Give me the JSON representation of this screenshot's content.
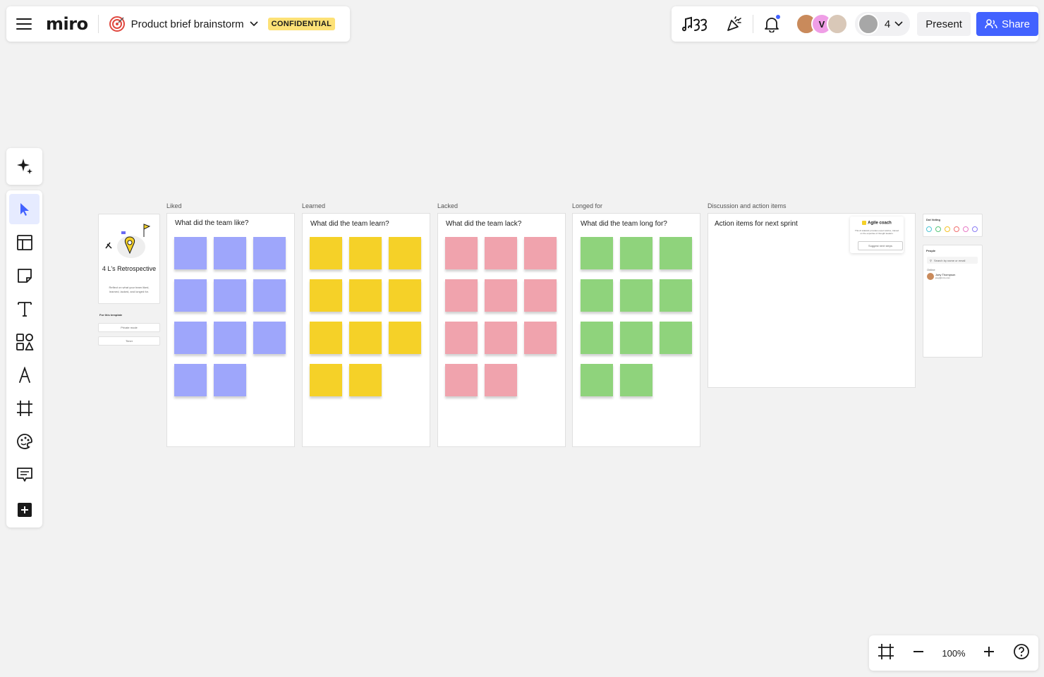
{
  "header": {
    "logo": "miro",
    "board_title": "Product brief brainstorm",
    "badge": "CONFIDENTIAL"
  },
  "topbar": {
    "avatars": [
      {
        "initial": "",
        "color": "#c98a5b"
      },
      {
        "initial": "V",
        "color": "#ef9ee6"
      },
      {
        "initial": "",
        "color": "#d9c8b8"
      }
    ],
    "collaborator_count": "4",
    "present_label": "Present",
    "share_label": "Share",
    "accent": "#4262ff"
  },
  "toolbar": {
    "tools": [
      "ai-sparkle-icon",
      "select-cursor-icon",
      "templates-icon",
      "sticky-note-icon",
      "text-icon",
      "shapes-icon",
      "pen-icon",
      "frame-icon",
      "reactions-icon",
      "comment-icon",
      "more-tools-icon"
    ]
  },
  "zoom": {
    "level": "100%"
  },
  "canvas": {
    "template_card": {
      "title": "4 L's Retrospective",
      "description": "Reflect on what your team liked, learned, lacked, and longed for.",
      "section": "For this template",
      "btn1": "Private mode",
      "btn2": "Timer"
    },
    "frames": [
      {
        "label": "Liked",
        "question": "What did the team like?",
        "color": "#9ea6fb",
        "count": 11
      },
      {
        "label": "Learned",
        "question": "What did the team learn?",
        "color": "#f5d128",
        "count": 11
      },
      {
        "label": "Lacked",
        "question": "What did the team lack?",
        "color": "#f0a3ad",
        "count": 11
      },
      {
        "label": "Longed for",
        "question": "What did the team long for?",
        "color": "#8fd37c",
        "count": 11
      }
    ],
    "discussion": {
      "label": "Discussion and action items",
      "title": "Action items for next sprint",
      "coach_title": "Agile coach",
      "coach_desc": "This Al sidekick provides expert advice, trained on the expertise of thought leaders.",
      "coach_btn": "Suggest next steps"
    },
    "dot_voting": {
      "title": "Dot Voting",
      "colors": [
        "#4ec5d5",
        "#59c77a",
        "#f5c227",
        "#f07070",
        "#e77ac6",
        "#8b7cf4"
      ]
    },
    "people": {
      "title": "People",
      "search_placeholder": "Search by name or email",
      "section": "Online",
      "person_name": "Joey Thompson",
      "person_email": "joey@miro.com"
    }
  }
}
